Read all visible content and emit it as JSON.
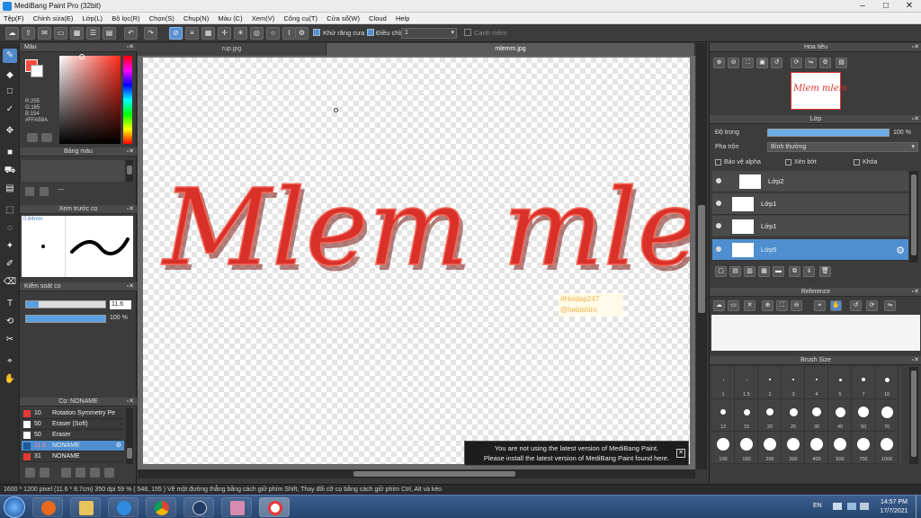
{
  "window": {
    "title": "MediBang Paint Pro (32bit)"
  },
  "menu": [
    "Tệp(F)",
    "Chỉnh sửa(E)",
    "Lớp(L)",
    "Bộ lọc(R)",
    "Chọn(S)",
    "Chụp(N)",
    "Màu (C)",
    "Xem(V)",
    "Công cụ(T)",
    "Cửa sổ(W)",
    "Cloud",
    "Help"
  ],
  "toolbar": {
    "antialias_label": "Khử răng cưa",
    "correction_label": "Điều chỉnh",
    "correction_value": "1",
    "snap_label": "Cạnh mềm"
  },
  "panels": {
    "color": {
      "title": "Màu",
      "r": "R:255",
      "g": "G:165",
      "b": "B:154",
      "hex": "#FFA59A",
      "fg": "#ff4a3a",
      "hue_hex": "#ff2a1a"
    },
    "palette": {
      "title": "Bảng màu",
      "dash": "---"
    },
    "brush_preview": {
      "title": "Xem trước cọ",
      "size": "0.84mm"
    },
    "brush_control": {
      "title": "Kiểm soát cọ",
      "size": "11.6",
      "opacity": "100 %",
      "size_fraction": 0.16,
      "opacity_fraction": 1.0
    },
    "brush_list": {
      "title": "Cọ: NONAME",
      "items": [
        {
          "size": "10",
          "name": "Rotation Symmetry Pe",
          "color": "#e53935"
        },
        {
          "size": "50",
          "name": "Eraser (Soft)",
          "color": "#ffffff"
        },
        {
          "size": "50",
          "name": "Eraser",
          "color": "#ffffff"
        },
        {
          "size": "11.6",
          "name": "NONAME",
          "color": "#1e5a9a",
          "selected": true
        },
        {
          "size": "31",
          "name": "NONAME",
          "color": "#e53935"
        }
      ]
    }
  },
  "tabs": [
    {
      "label": "rup.jpg"
    },
    {
      "label": "mlemm.jpg",
      "active": true
    }
  ],
  "canvas": {
    "art_text": "Mlem mlem",
    "watermark_1": "#Hoidap247",
    "watermark_2": "@hebishiro",
    "art_color": "#d9302a"
  },
  "notification": {
    "line1": "You are not using the latest version of MediBang Paint.",
    "line2": "Please install the latest version of MediBang Paint found here."
  },
  "navigator": {
    "title": "Hoa tiêu",
    "thumb_text": "Mlem mlem"
  },
  "layers": {
    "title": "Lớp",
    "opacity_label": "Độ trong",
    "opacity_value": "100 %",
    "opacity_fraction": 1.0,
    "blend_label": "Pha trộn",
    "blend_value": "Bình thường",
    "protect_alpha": "Bảo vệ alpha",
    "clipping": "Xén bớt",
    "lock": "Khóa",
    "items": [
      {
        "name": "Lớp2"
      },
      {
        "name": "Lớp1"
      },
      {
        "name": "Lớp1"
      },
      {
        "name": "Lớp5",
        "selected": true
      }
    ]
  },
  "reference": {
    "title": "Reference"
  },
  "brush_size": {
    "title": "Brush Size",
    "row1": [
      "1",
      "1.5",
      "2",
      "3",
      "4",
      "5",
      "7",
      "10"
    ],
    "row2": [
      "12",
      "15",
      "20",
      "25",
      "30",
      "40",
      "50",
      "70"
    ],
    "row3": [
      "100",
      "150",
      "200",
      "300",
      "400",
      "500",
      "700",
      "1000"
    ]
  },
  "status": {
    "text": "1600 * 1200 pixel   (11.6 * 8.7cm)   350 dpi   59 %   ( 548, 155 )   Vẽ một đường thẳng bằng cách giữ phím Shift, Thay đổi cỡ cọ bằng cách giữ phím Ctrl, Alt và kéo"
  },
  "taskbar": {
    "lang": "EN",
    "time": "14:57 PM",
    "date": "17/7/2021"
  }
}
